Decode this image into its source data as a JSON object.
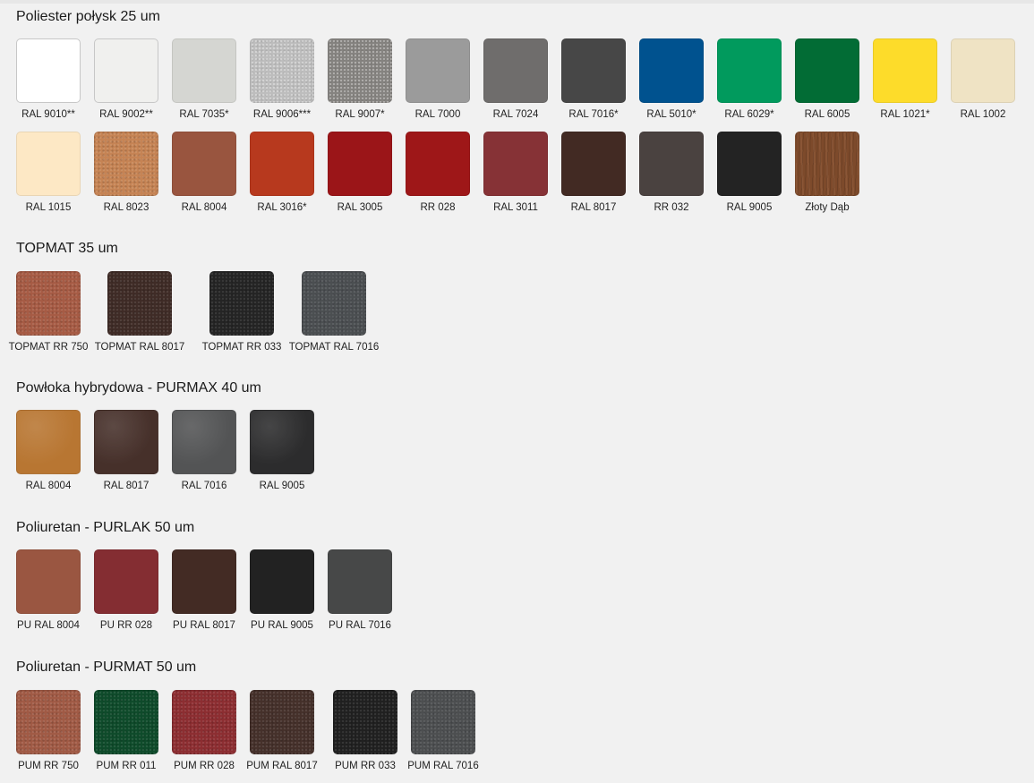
{
  "sections": [
    {
      "title": "Poliester połysk 25 um",
      "swatches": [
        {
          "label": "RAL 9010**",
          "color": "#ffffff"
        },
        {
          "label": "RAL 9002**",
          "color": "#f0f0ee"
        },
        {
          "label": "RAL 7035*",
          "color": "#d5d6d2"
        },
        {
          "label": "RAL 9006***",
          "color": "#bdbdbd"
        },
        {
          "label": "RAL 9007*",
          "color": "#858380"
        },
        {
          "label": "RAL 7000",
          "color": "#9b9b9b"
        },
        {
          "label": "RAL 7024",
          "color": "#6f6d6c"
        },
        {
          "label": "RAL 7016*",
          "color": "#474747"
        },
        {
          "label": "RAL 5010*",
          "color": "#00528f"
        },
        {
          "label": "RAL 6029*",
          "color": "#019a5d"
        },
        {
          "label": "RAL 6005",
          "color": "#026c35"
        },
        {
          "label": "RAL 1021*",
          "color": "#fddc2a"
        },
        {
          "label": "RAL 1002",
          "color": "#efe3c4"
        },
        {
          "label": "RAL 1015",
          "color": "#fde8c5"
        },
        {
          "label": "RAL 8023",
          "color": "#c58354"
        },
        {
          "label": "RAL 8004",
          "color": "#99553f"
        },
        {
          "label": "RAL 3016*",
          "color": "#b7391e"
        },
        {
          "label": "RAL 3005",
          "color": "#9b1518"
        },
        {
          "label": "RR 028",
          "color": "#9e1718"
        },
        {
          "label": "RAL 3011",
          "color": "#863236"
        },
        {
          "label": "RAL 8017",
          "color": "#422a23"
        },
        {
          "label": "RR 032",
          "color": "#4a4240"
        },
        {
          "label": "RAL 9005",
          "color": "#232323"
        },
        {
          "label": "Złoty Dąb",
          "color": "#7d4a2b"
        }
      ]
    },
    {
      "title": "TOPMAT 35 um",
      "swatches": [
        {
          "label": "TOPMAT RR 750",
          "color": "#a65b44"
        },
        {
          "label": "TOPMAT RAL 8017",
          "color": "#3f2b26"
        },
        {
          "label": "TOPMAT RR 033",
          "color": "#242424"
        },
        {
          "label": "TOPMAT RAL 7016",
          "color": "#4b4e51"
        }
      ]
    },
    {
      "title": "Powłoka hybrydowa - PURMAX 40 um",
      "swatches": [
        {
          "label": "RAL 8004",
          "color": "#b87632"
        },
        {
          "label": "RAL 8017",
          "color": "#46302a"
        },
        {
          "label": "RAL 7016",
          "color": "#535455"
        },
        {
          "label": "RAL 9005",
          "color": "#2c2c2d"
        }
      ]
    },
    {
      "title": "Poliuretan - PURLAK 50 um",
      "swatches": [
        {
          "label": "PU RAL 8004",
          "color": "#9a5641"
        },
        {
          "label": "PU RR 028",
          "color": "#842d32"
        },
        {
          "label": "PU RAL 8017",
          "color": "#432b24"
        },
        {
          "label": "PU RAL 9005",
          "color": "#222222"
        },
        {
          "label": "PU RAL 7016",
          "color": "#474848"
        }
      ]
    },
    {
      "title": "Poliuretan - PURMAT 50 um",
      "swatches": [
        {
          "label": "PUM RR 750",
          "color": "#a05a45"
        },
        {
          "label": "PUM RR 011",
          "color": "#0e4a2a"
        },
        {
          "label": "PUM RR 028",
          "color": "#8c2d31"
        },
        {
          "label": "PUM RAL 8017",
          "color": "#45302a"
        },
        {
          "label": "PUM RR 033",
          "color": "#202020"
        },
        {
          "label": "PUM RAL 7016",
          "color": "#4c4e50"
        }
      ]
    }
  ]
}
